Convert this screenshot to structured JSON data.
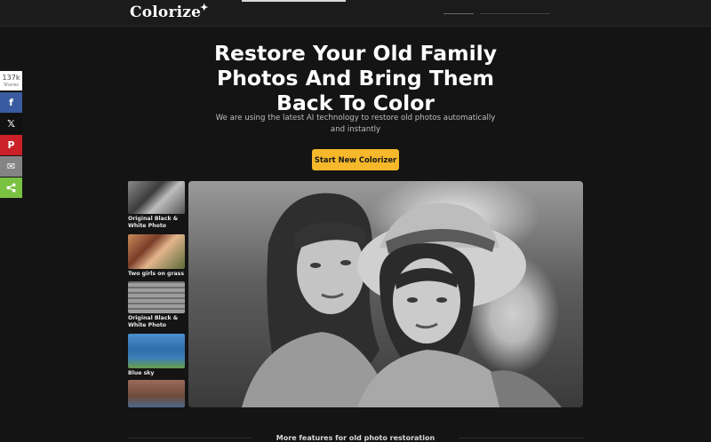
{
  "header": {
    "logo_text": "Colorize",
    "logo_sparkle": "✦"
  },
  "hero": {
    "title": "Restore Your Old Family Photos And Bring Them Back To Color",
    "subtitle": "We are using the latest AI technology to restore old photos automatically and instantly",
    "cta_label": "Start New Colorizer"
  },
  "share": {
    "count": "137k",
    "count_label": "Shares",
    "buttons": [
      {
        "name": "facebook",
        "glyph": "f"
      },
      {
        "name": "x",
        "glyph": "𝕏"
      },
      {
        "name": "pinterest",
        "glyph": "P"
      },
      {
        "name": "email",
        "glyph": "✉"
      },
      {
        "name": "share",
        "glyph": "⋖"
      }
    ]
  },
  "gallery": {
    "items": [
      {
        "caption": "Original Black & White Photo"
      },
      {
        "caption": "Two girls on grass"
      },
      {
        "caption": "Original Black & White Photo"
      },
      {
        "caption": "Blue sky"
      },
      {
        "caption": ""
      }
    ]
  },
  "footer": {
    "section_heading": "More features for old photo restoration"
  },
  "colors": {
    "background": "#141414",
    "accent": "#f5b82a",
    "facebook": "#3a5ba0",
    "pinterest": "#cb2027",
    "share": "#7ac142"
  }
}
